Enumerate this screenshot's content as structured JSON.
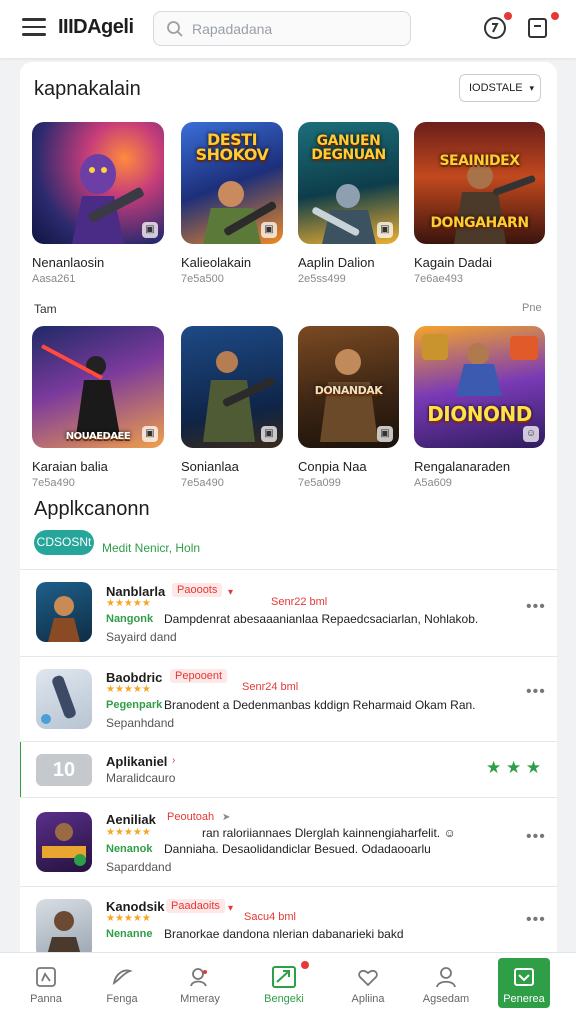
{
  "header": {
    "app_name": "IIIDAgeli",
    "search_placeholder": "Rapadadana",
    "icons": [
      "menu-icon",
      "search-icon",
      "clock-notification-icon",
      "inbox-notification-icon"
    ]
  },
  "featured": {
    "title": "kapnakalain",
    "sort_label": "IODSTALE",
    "row_label": "Tam",
    "row_more": "Pne",
    "games": [
      {
        "name": "Nenanlaosin",
        "sub": "Aasa261",
        "art_title": ""
      },
      {
        "name": "Kalieolakain",
        "sub": "7e5a500",
        "art_title": "DESTI SHOKOV"
      },
      {
        "name": "Aaplin Dalion",
        "sub": "2e5ss499",
        "art_title": "GANUEN DEGNUAN"
      },
      {
        "name": "Kagain Dadai",
        "sub": "7e6ae493",
        "art_title": "SEAINIDEX DONGAHARN"
      },
      {
        "name": "Karaian balia",
        "sub": "7e5a490",
        "art_title": "NOUAEDAEE"
      },
      {
        "name": "Sonianlaa",
        "sub": "7e5a490",
        "art_title": ""
      },
      {
        "name": "Conpia Naa",
        "sub": "7e5a099",
        "art_title": "DONANDAK"
      },
      {
        "name": "Rengalanaraden",
        "sub": "A5a609",
        "art_title": "DIONOND"
      }
    ]
  },
  "apps": {
    "title": "Applkcanonn",
    "pill": "CDSOSNt",
    "pill_note": "Medit Nenicr, Holn",
    "items": [
      {
        "title": "Nanblarla",
        "tag": "Paooots",
        "size": "Senr22 bml",
        "stars": "★★★★★",
        "green": "Nangonk",
        "desc": "Dampdenrat abesaaanianlaa Repaedcsaciarlan, Nohlakob.",
        "sub": "Sayaird dand",
        "rating": 4
      },
      {
        "title": "Baobdric",
        "tag": "Pepooent",
        "size": "Senr24 bml",
        "stars": "★★★★★",
        "green": "Pegenpark",
        "desc": "Branodent a Dedenmanbas kddign Reharmaid Okam Ran.",
        "sub": "Sepanhdand",
        "rating": 4
      },
      {
        "title": "Aplikaniel",
        "tag": "",
        "size": "",
        "stars": "★ ★ ★",
        "green": "",
        "desc": "",
        "sub": "Maralidcauro",
        "icon_text": "10",
        "rating": 3
      },
      {
        "title": "Aeniliak",
        "tag": "Peoutoah",
        "size": "",
        "stars": "★★★★★",
        "green": "Nenanok",
        "desc": "Danniaha. Desaolidandiclar Besued. Odadaooarlu",
        "desc_top": "ran raloriiannaes Dlerglah kainnengiaharfelit. ☺",
        "sub": "Saparddand",
        "rating": 4
      },
      {
        "title": "Kanodsik",
        "tag": "Paadaoits",
        "size": "Sacu4 bml",
        "stars": "★★★★★",
        "green": "Nenanne",
        "desc": "Branorkae dandona nlerian dabanarieki bakd",
        "sub": "",
        "rating": 4
      }
    ]
  },
  "bottom_nav": [
    {
      "label": "Panna",
      "icon": "library-icon"
    },
    {
      "label": "Fenga",
      "icon": "ring-icon"
    },
    {
      "label": "Mmeray",
      "icon": "users-icon"
    },
    {
      "label": "Bengeki",
      "icon": "trending-icon"
    },
    {
      "label": "Apliina",
      "icon": "heart-icon"
    },
    {
      "label": "Agsedam",
      "icon": "profile-icon"
    },
    {
      "label": "Penerea",
      "icon": "store-icon"
    }
  ],
  "colors": {
    "accent": "#2e9e47",
    "tag_red": "#e53935",
    "star": "#f5a623",
    "pill": "#26a69a"
  }
}
